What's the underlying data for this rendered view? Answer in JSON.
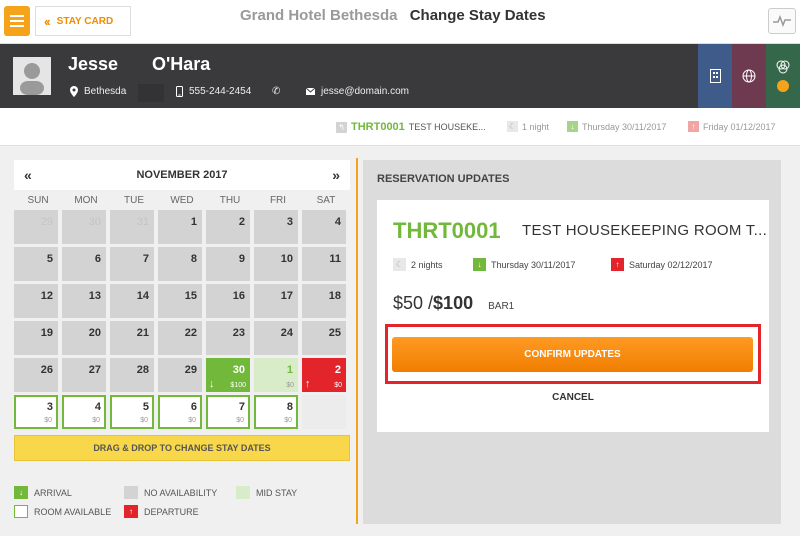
{
  "topbar": {
    "stay_card_label": "STAY CARD",
    "hotel_name": "Grand Hotel Bethesda",
    "page_title": "Change Stay Dates"
  },
  "guest": {
    "first_name": "Jesse",
    "last_name": "O'Hara",
    "city": "Bethesda",
    "phone": "555-244-2454",
    "email": "jesse@domain.com"
  },
  "summary": {
    "room_code": "THRT0001",
    "room_name": "TEST HOUSEKE...",
    "nights": "1 night",
    "arrival": "Thursday 30/11/2017",
    "departure": "Friday 01/12/2017"
  },
  "calendar": {
    "month_label": "NOVEMBER 2017",
    "prev_label": "«",
    "next_label": "»",
    "weekdays": [
      "SUN",
      "MON",
      "TUE",
      "WED",
      "THU",
      "FRI",
      "SAT"
    ],
    "days": [
      {
        "label": "29",
        "state": "other"
      },
      {
        "label": "30",
        "state": "other"
      },
      {
        "label": "31",
        "state": "other"
      },
      {
        "label": "1",
        "state": "none"
      },
      {
        "label": "2",
        "state": "none"
      },
      {
        "label": "3",
        "state": "none"
      },
      {
        "label": "4",
        "state": "none"
      },
      {
        "label": "5",
        "state": "none"
      },
      {
        "label": "6",
        "state": "none"
      },
      {
        "label": "7",
        "state": "none"
      },
      {
        "label": "8",
        "state": "none"
      },
      {
        "label": "9",
        "state": "none"
      },
      {
        "label": "10",
        "state": "none"
      },
      {
        "label": "11",
        "state": "none"
      },
      {
        "label": "12",
        "state": "none"
      },
      {
        "label": "13",
        "state": "none"
      },
      {
        "label": "14",
        "state": "none"
      },
      {
        "label": "15",
        "state": "none"
      },
      {
        "label": "16",
        "state": "none"
      },
      {
        "label": "17",
        "state": "none"
      },
      {
        "label": "18",
        "state": "none"
      },
      {
        "label": "19",
        "state": "none"
      },
      {
        "label": "20",
        "state": "none"
      },
      {
        "label": "21",
        "state": "none"
      },
      {
        "label": "22",
        "state": "none"
      },
      {
        "label": "23",
        "state": "none"
      },
      {
        "label": "24",
        "state": "none"
      },
      {
        "label": "25",
        "state": "none"
      },
      {
        "label": "26",
        "state": "none"
      },
      {
        "label": "27",
        "state": "none"
      },
      {
        "label": "28",
        "state": "none"
      },
      {
        "label": "29",
        "state": "none"
      },
      {
        "label": "30",
        "state": "arrival",
        "price": "$100"
      },
      {
        "label": "1",
        "state": "midstay",
        "price": "$0"
      },
      {
        "label": "2",
        "state": "departure",
        "price": "$0"
      },
      {
        "label": "3",
        "state": "avail",
        "price": "$0"
      },
      {
        "label": "4",
        "state": "avail",
        "price": "$0"
      },
      {
        "label": "5",
        "state": "avail",
        "price": "$0"
      },
      {
        "label": "6",
        "state": "avail",
        "price": "$0"
      },
      {
        "label": "7",
        "state": "avail",
        "price": "$0"
      },
      {
        "label": "8",
        "state": "avail",
        "price": "$0"
      },
      {
        "label": "",
        "state": "blank"
      }
    ],
    "drag_hint": "DRAG & DROP TO CHANGE STAY DATES"
  },
  "legend": {
    "arrival": "ARRIVAL",
    "no_availability": "NO AVAILABILITY",
    "mid_stay": "MID STAY",
    "room_available": "ROOM AVAILABLE",
    "departure": "DEPARTURE"
  },
  "reservation": {
    "section_title": "RESERVATION UPDATES",
    "room_code": "THRT0001",
    "room_name": "TEST HOUSEKEEPING ROOM T...",
    "nights": "2 nights",
    "arrival": "Thursday 30/11/2017",
    "departure": "Saturday 02/12/2017",
    "old_price": "$50 /",
    "new_price": "$100",
    "rate_code": "BAR1",
    "confirm_label": "CONFIRM UPDATES",
    "cancel_label": "CANCEL"
  },
  "colors": {
    "accent_orange": "#f5a31a",
    "arrival_green": "#72b83a",
    "departure_red": "#e3242b",
    "mid_stay_green": "#d9ecc9",
    "highlight_red": "#e3242b"
  },
  "icons": [
    "menu-icon",
    "chevron-left-icon",
    "pulse-icon",
    "avatar-icon",
    "location-icon",
    "mobile-icon",
    "phone-icon",
    "email-icon",
    "building-icon",
    "globe-icon",
    "circles-icon",
    "back-arrow-icon",
    "moon-icon",
    "arrow-down-icon",
    "arrow-up-icon"
  ]
}
